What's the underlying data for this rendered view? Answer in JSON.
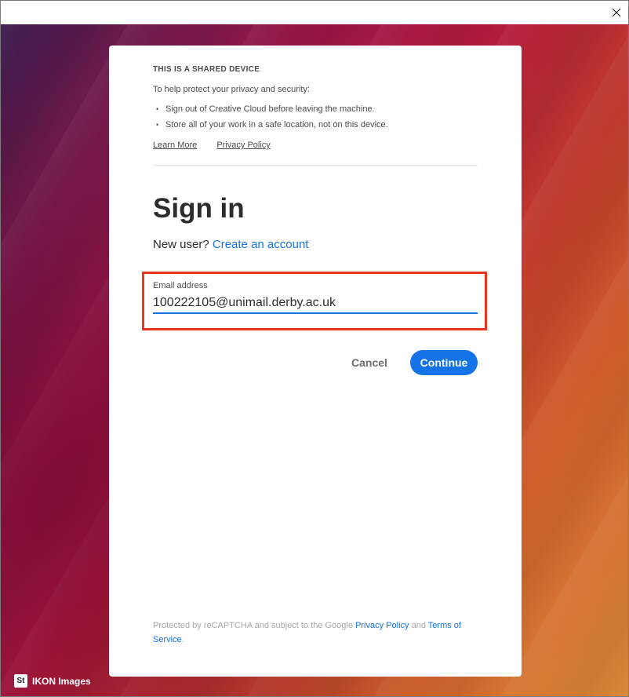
{
  "window": {
    "close_icon": "close-icon"
  },
  "background": {
    "credit_badge": "St",
    "credit_label": "IKON Images"
  },
  "shared_device": {
    "title": "THIS IS A SHARED DEVICE",
    "description": "To help protect your privacy and security:",
    "bullets": [
      "Sign out of Creative Cloud before leaving the machine.",
      "Store all of your work in a safe location, not on this device."
    ],
    "learn_more": "Learn More",
    "privacy_policy": "Privacy Policy"
  },
  "signin": {
    "title": "Sign in",
    "new_user_prefix": "New user?",
    "create_account": "Create an account",
    "email_label": "Email address",
    "email_value": "100222105@unimail.derby.ac.uk",
    "cancel_label": "Cancel",
    "continue_label": "Continue"
  },
  "recaptcha": {
    "text_1": "Protected by reCAPTCHA and subject to the Google",
    "privacy_link": "Privacy Policy",
    "text_2": "and",
    "terms_link": "Terms of Service",
    "text_3": "."
  },
  "colors": {
    "accent": "#1473e6",
    "highlight": "#e8351e"
  }
}
